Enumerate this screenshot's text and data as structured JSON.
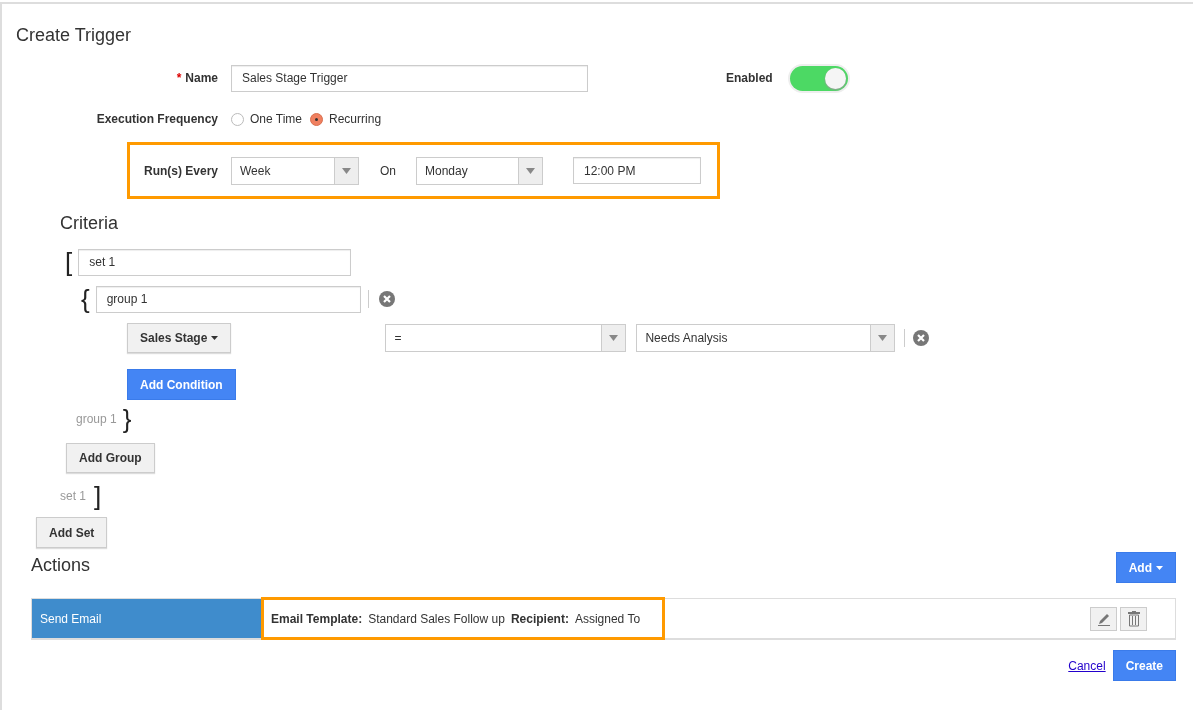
{
  "title": "Create Trigger",
  "name_field": {
    "required_mark": "*",
    "label": "Name",
    "value": "Sales Stage Trigger"
  },
  "enabled": {
    "label": "Enabled",
    "on": true
  },
  "execution_frequency": {
    "label": "Execution Frequency",
    "options": [
      {
        "label": "One Time",
        "selected": false
      },
      {
        "label": "Recurring",
        "selected": true
      }
    ]
  },
  "schedule": {
    "highlighted": true,
    "label": "Run(s) Every",
    "interval": "Week",
    "on_label": "On",
    "day": "Monday",
    "time": "12:00 PM"
  },
  "criteria": {
    "title": "Criteria",
    "set": {
      "open_bracket": "[",
      "name": "set 1",
      "group": {
        "open_bracket": "{",
        "name": "group 1",
        "conditions": [
          {
            "field": "Sales Stage",
            "operator": "=",
            "value": "Needs Analysis"
          }
        ],
        "add_condition": "Add Condition",
        "closing_label": "group 1",
        "close_bracket": "}"
      },
      "add_group": "Add Group",
      "closing_label": "set 1",
      "close_bracket": "]"
    },
    "add_set": "Add Set"
  },
  "actions": {
    "title": "Actions",
    "add_button": "Add",
    "items": [
      {
        "type": "Send Email",
        "highlighted": true,
        "details": [
          {
            "label": "Email Template:",
            "value": "Standard Sales Follow up"
          },
          {
            "label": "Recipient:",
            "value": "Assigned To"
          }
        ]
      }
    ]
  },
  "footer": {
    "cancel": "Cancel",
    "create": "Create"
  }
}
